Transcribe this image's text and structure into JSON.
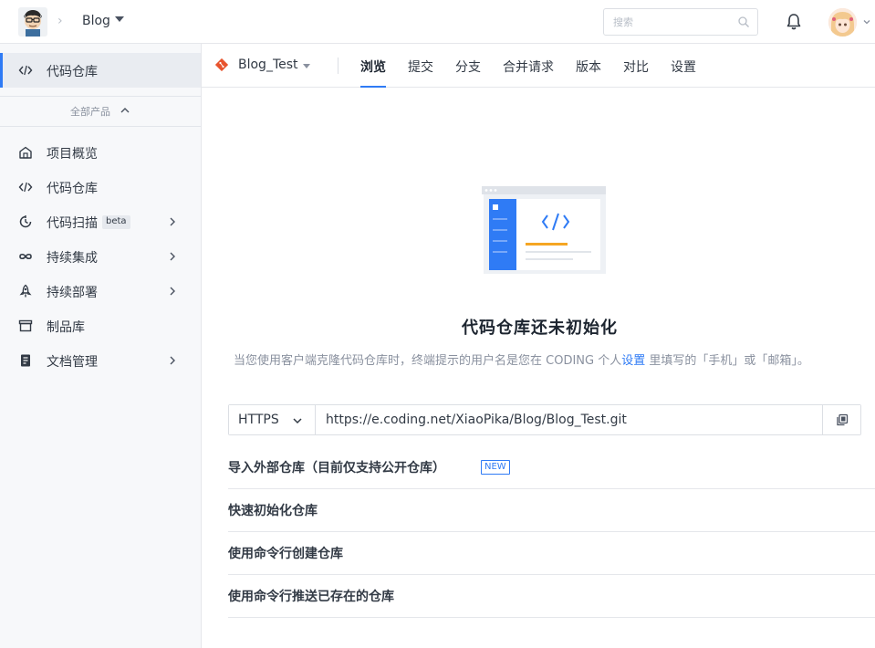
{
  "header": {
    "breadcrumb_sep": "›",
    "project_name": "Blog",
    "search_placeholder": "搜索"
  },
  "sidebar": {
    "active_item": {
      "label": "代码仓库",
      "icon": "code-icon"
    },
    "all_products_label": "全部产品",
    "items": [
      {
        "label": "项目概览",
        "icon": "home-icon",
        "has_arrow": false
      },
      {
        "label": "代码仓库",
        "icon": "code-icon",
        "has_arrow": false
      },
      {
        "label": "代码扫描",
        "icon": "scan-icon",
        "badge": "beta",
        "has_arrow": true
      },
      {
        "label": "持续集成",
        "icon": "infinity-icon",
        "has_arrow": true
      },
      {
        "label": "持续部署",
        "icon": "rocket-icon",
        "has_arrow": true
      },
      {
        "label": "制品库",
        "icon": "archive-icon",
        "has_arrow": false
      },
      {
        "label": "文档管理",
        "icon": "document-icon",
        "has_arrow": true
      }
    ]
  },
  "repo": {
    "name": "Blog_Test",
    "tabs": [
      {
        "label": "浏览",
        "active": true
      },
      {
        "label": "提交",
        "active": false
      },
      {
        "label": "分支",
        "active": false
      },
      {
        "label": "合并请求",
        "active": false
      },
      {
        "label": "版本",
        "active": false
      },
      {
        "label": "对比",
        "active": false
      },
      {
        "label": "设置",
        "active": false
      }
    ]
  },
  "empty_state": {
    "title": "代码仓库还未初始化",
    "desc_before": "当您使用客户端克隆代码仓库时，终端提示的用户名是您在 CODING 个人",
    "desc_link": "设置",
    "desc_after": " 里填写的「手机」或「邮箱」。"
  },
  "clone": {
    "protocol": "HTTPS",
    "url": "https://e.coding.net/XiaoPika/Blog/Blog_Test.git"
  },
  "sections": [
    {
      "label": "导入外部仓库（目前仅支持公开仓库）",
      "badge": "NEW"
    },
    {
      "label": "快速初始化仓库"
    },
    {
      "label": "使用命令行创建仓库"
    },
    {
      "label": "使用命令行推送已存在的仓库"
    }
  ],
  "colors": {
    "accent": "#2f7bf5",
    "repo_icon": "#e8542e",
    "illustration_orange": "#f5a623"
  }
}
